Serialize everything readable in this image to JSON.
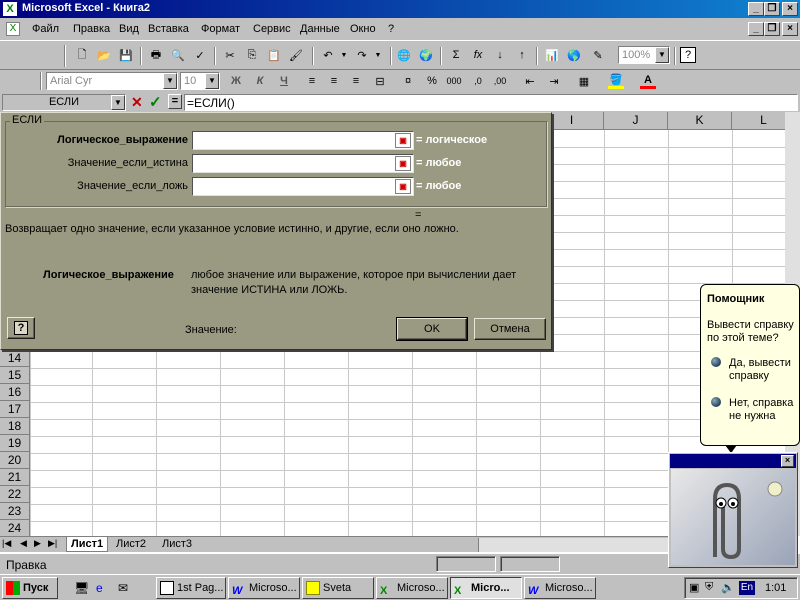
{
  "window": {
    "title": "Microsoft Excel - Книга2"
  },
  "menu": {
    "items": [
      "Файл",
      "Правка",
      "Вид",
      "Вставка",
      "Формат",
      "Сервис",
      "Данные",
      "Окно",
      "?"
    ]
  },
  "format": {
    "font": "Arial Cyr",
    "size": "10",
    "zoom": "100%"
  },
  "formula": {
    "name_box": "ЕСЛИ",
    "content": "=ЕСЛИ()"
  },
  "grid": {
    "columns": [
      "I",
      "J",
      "K",
      "L"
    ],
    "rows": [
      "14",
      "15",
      "16",
      "17",
      "18",
      "19",
      "20",
      "21",
      "22",
      "23",
      "24"
    ]
  },
  "dialog": {
    "group_title": "ЕСЛИ",
    "args": [
      {
        "label": "Логическое_выражение",
        "result": "= логическое"
      },
      {
        "label": "Значение_если_истина",
        "result": "= любое"
      },
      {
        "label": "Значение_если_ложь",
        "result": "= любое"
      }
    ],
    "equals": "=",
    "description": "Возвращает одно значение, если указанное условие истинно, и другие, если оно ложно.",
    "arg_help_name": "Логическое_выражение",
    "arg_help_text1": "любое значение или выражение, которое при вычислении дает",
    "arg_help_text2": "значение ИСТИНА или ЛОЖЬ.",
    "help_glyph": "?",
    "value_label": "Значение:",
    "ok": "OK",
    "cancel": "Отмена"
  },
  "sheets": {
    "tabs": [
      "Лист1",
      "Лист2",
      "Лист3"
    ]
  },
  "status": {
    "text": "Правка"
  },
  "assistant": {
    "title": "Помощник",
    "question": "Вывести справку по этой теме?",
    "option1": "Да, вывести справку",
    "option2": "Нет, справка не нужна"
  },
  "taskbar": {
    "start": "Пуск",
    "tasks": [
      "1st Pag...",
      "Microso...",
      "Sveta",
      "Microso...",
      "Micro...",
      "Microso..."
    ],
    "lang": "En",
    "clock": "1:01"
  },
  "colors": {
    "title_bar": "#000080",
    "dialog_bg": "#9a9a82",
    "bubble_bg": "#ffffe1"
  }
}
